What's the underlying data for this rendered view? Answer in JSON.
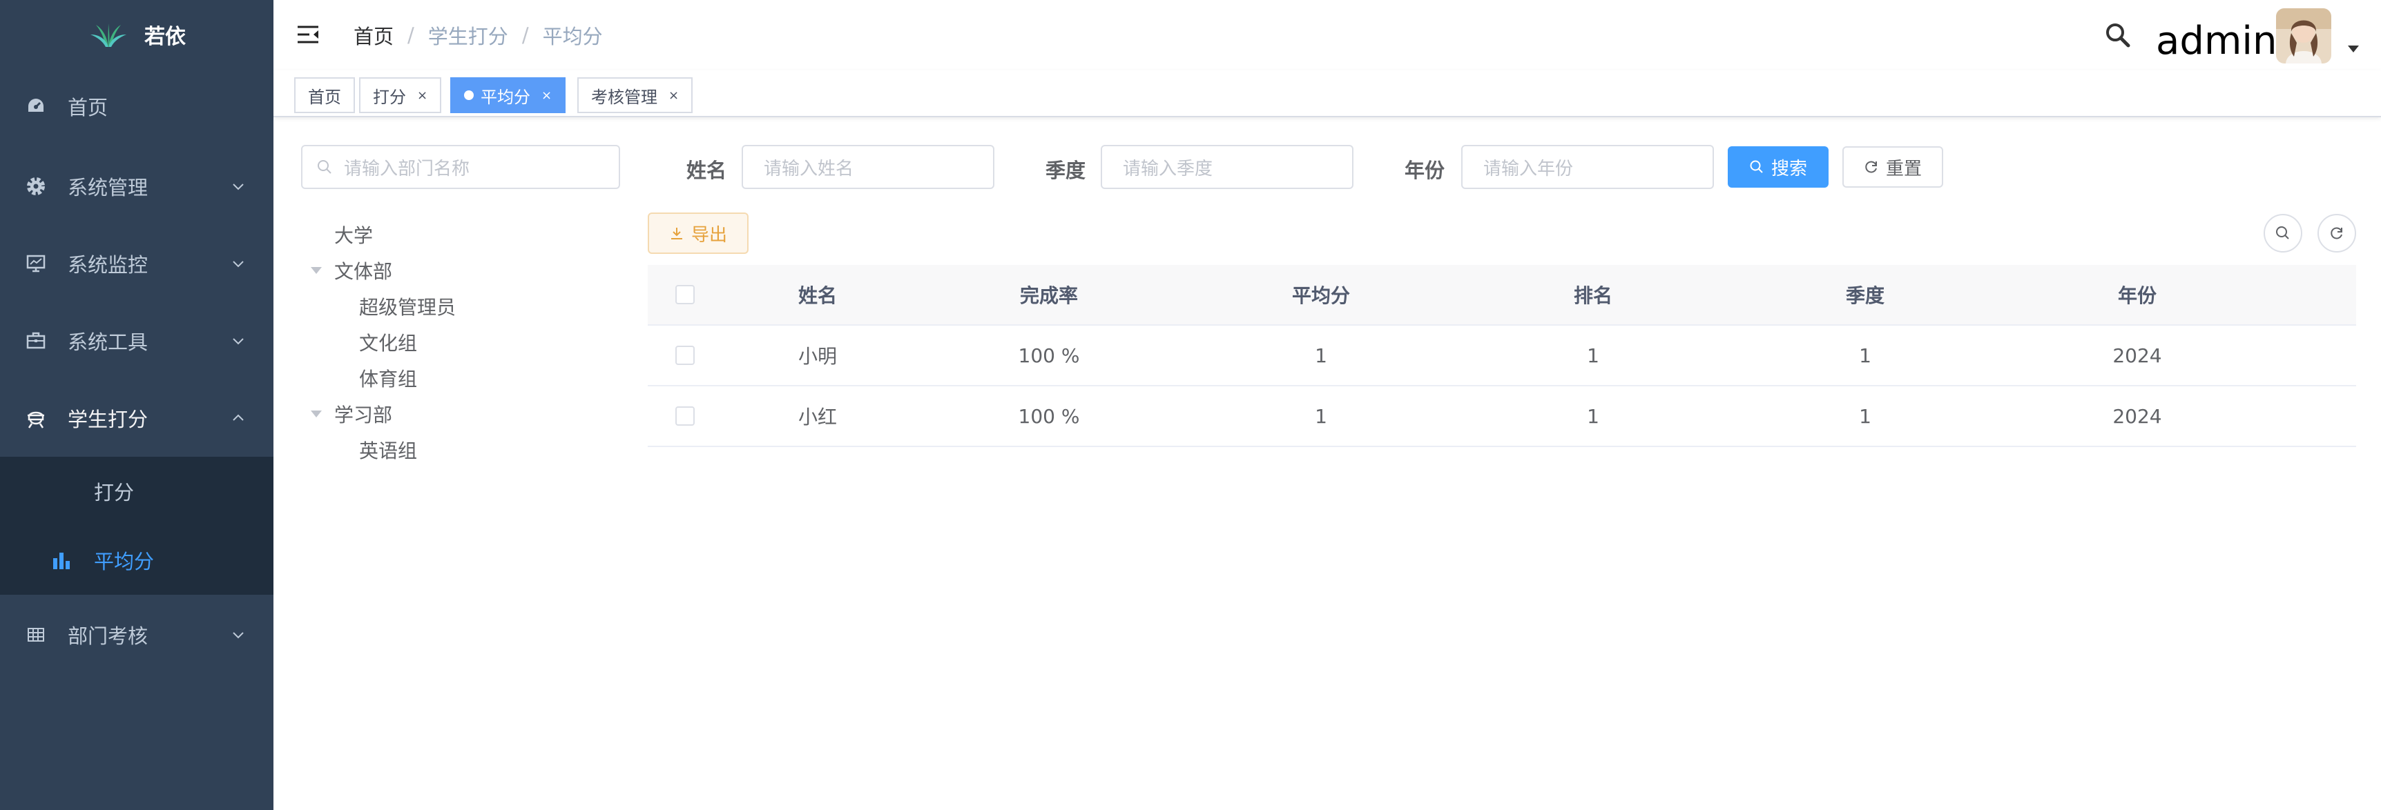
{
  "app": {
    "title": "若依"
  },
  "sidebar": {
    "items": [
      {
        "label": "首页",
        "icon": "dashboard-icon"
      },
      {
        "label": "系统管理",
        "icon": "gear-icon"
      },
      {
        "label": "系统监控",
        "icon": "monitor-icon"
      },
      {
        "label": "系统工具",
        "icon": "toolbox-icon"
      },
      {
        "label": "学生打分",
        "icon": "student-icon",
        "expanded": true,
        "children": [
          {
            "label": "打分"
          },
          {
            "label": "平均分",
            "icon": "bar-chart-icon",
            "active": true
          }
        ]
      },
      {
        "label": "部门考核",
        "icon": "table-icon"
      }
    ]
  },
  "navbar": {
    "breadcrumb": [
      "首页",
      "学生打分",
      "平均分"
    ],
    "separator": "/",
    "username": "admin"
  },
  "tags": [
    {
      "label": "首页",
      "closable": false
    },
    {
      "label": "打分",
      "closable": true
    },
    {
      "label": "平均分",
      "closable": true,
      "active": true
    },
    {
      "label": "考核管理",
      "closable": true
    }
  ],
  "tag_close": "×",
  "dept": {
    "placeholder": "请输入部门名称",
    "tree": [
      {
        "label": "大学",
        "level": 0,
        "arrow": false
      },
      {
        "label": "文体部",
        "level": 1,
        "arrow": true
      },
      {
        "label": "超级管理员",
        "level": 2
      },
      {
        "label": "文化组",
        "level": 2
      },
      {
        "label": "体育组",
        "level": 2
      },
      {
        "label": "学习部",
        "level": 1,
        "arrow": true
      },
      {
        "label": "英语组",
        "level": 2
      }
    ]
  },
  "form": {
    "name_label": "姓名",
    "name_placeholder": "请输入姓名",
    "season_label": "季度",
    "season_placeholder": "请输入季度",
    "year_label": "年份",
    "year_placeholder": "请输入年份",
    "search_button": "搜索",
    "reset_button": "重置",
    "export_button": "导出"
  },
  "table": {
    "columns": [
      "姓名",
      "完成率",
      "平均分",
      "排名",
      "季度",
      "年份"
    ],
    "rows": [
      [
        "小明",
        "100 %",
        "1",
        "1",
        "1",
        "2024"
      ],
      [
        "小红",
        "100 %",
        "1",
        "1",
        "1",
        "2024"
      ]
    ]
  },
  "colors": {
    "sidebar_bg": "#304156",
    "submenu_bg": "#1f2d3d",
    "active": "#409eff",
    "tag_active": "#5a9cf8"
  }
}
